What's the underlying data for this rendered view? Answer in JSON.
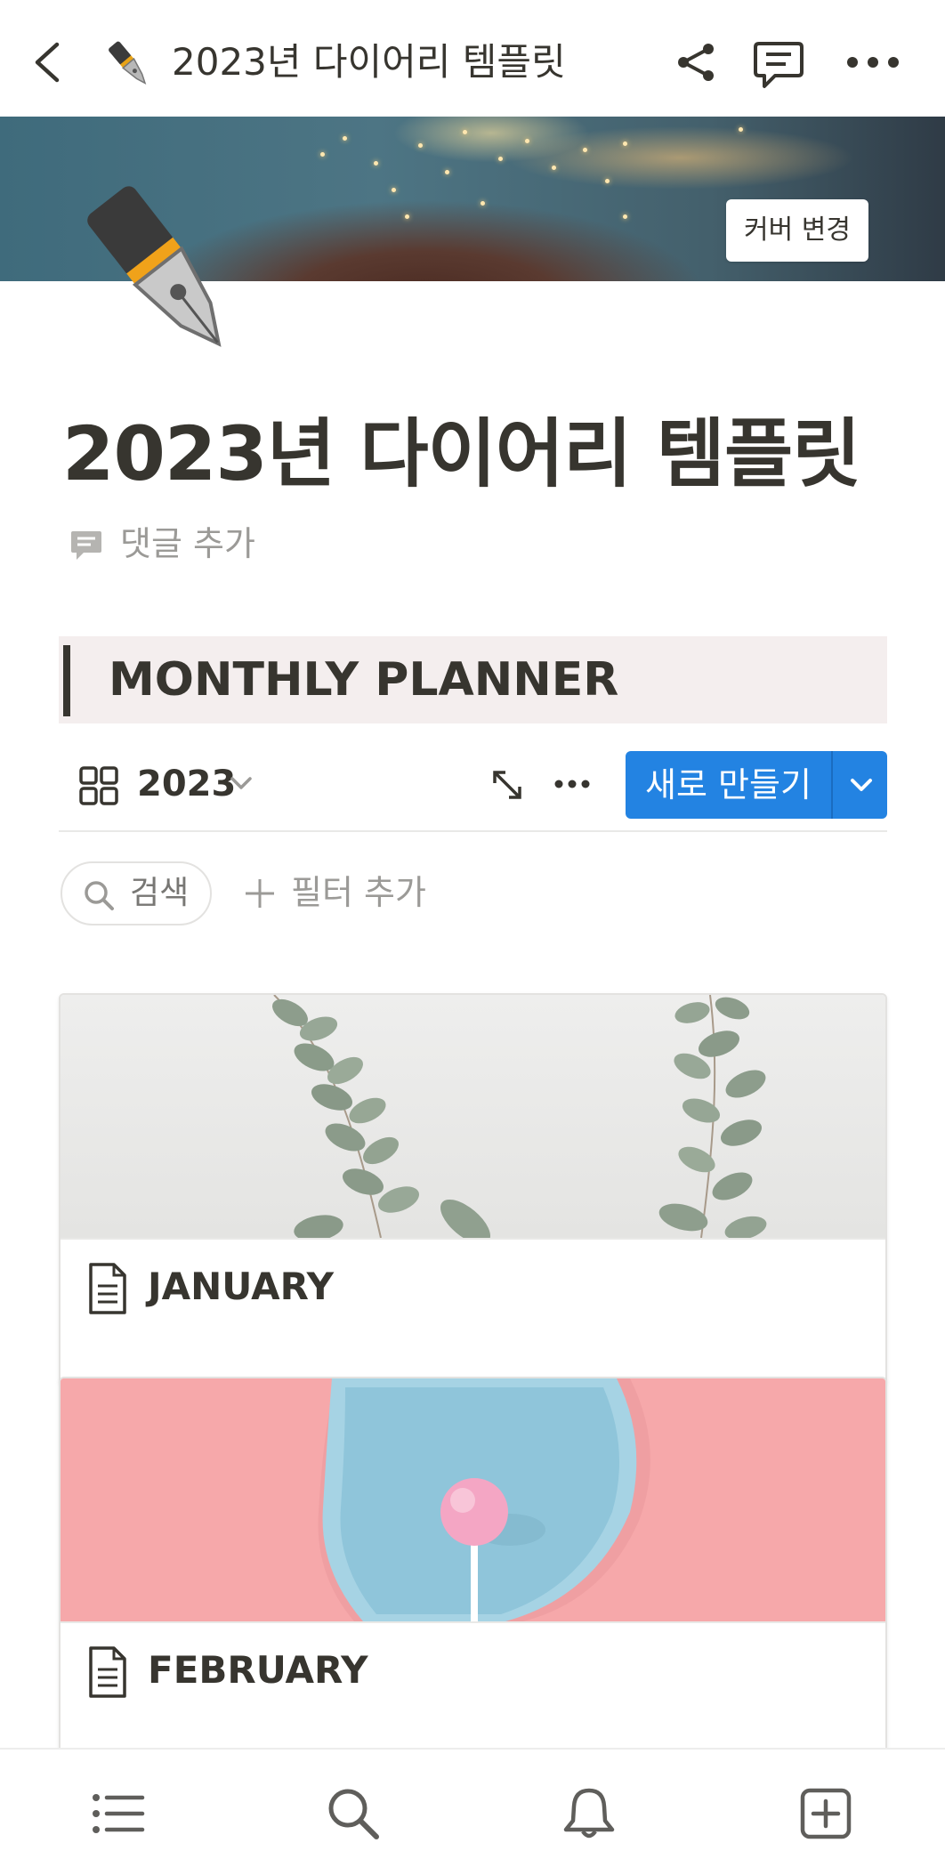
{
  "topbar": {
    "page_icon": "fountain-pen-emoji",
    "title": "2023년 다이어리 템플릿",
    "icons": [
      "back-icon",
      "share-icon",
      "comment-icon",
      "more-icon"
    ]
  },
  "cover": {
    "change_cover_label": "커버 변경"
  },
  "page": {
    "icon": "fountain-pen-emoji",
    "title": "2023년 다이어리 템플릿",
    "add_comment_label": "댓글 추가"
  },
  "section": {
    "heading": "MONTHLY PLANNER"
  },
  "database": {
    "view_name": "2023",
    "view_icon": "gallery-icon",
    "new_button_label": "새로 만들기",
    "search_label": "검색",
    "add_filter_label": "필터 추가",
    "cards": [
      {
        "title": "JANUARY",
        "cover": "eucalyptus-branches"
      },
      {
        "title": "FEBRUARY",
        "cover": "lollipop-on-blue-plate"
      }
    ]
  },
  "bottombar": {
    "icons": [
      "list-icon",
      "search-icon",
      "bell-icon",
      "new-page-icon"
    ]
  },
  "colors": {
    "accent": "#2383e2",
    "callout_bg": "#f4eeee",
    "text": "#37352f",
    "muted": "#9b9a97"
  }
}
